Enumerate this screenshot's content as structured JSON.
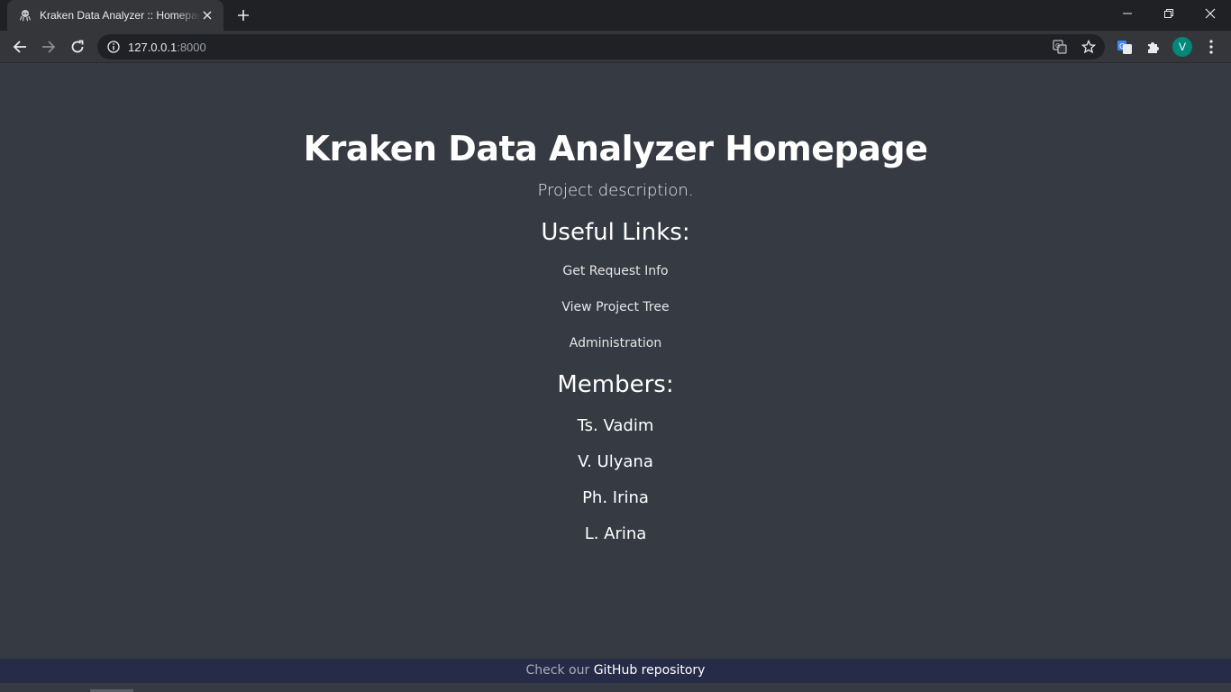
{
  "browser": {
    "tab_title": "Kraken Data Analyzer :: Homepage",
    "url_host": "127.0.0.1",
    "url_port": ":8000",
    "avatar_letter": "V",
    "colors": {
      "titlebar": "#202124",
      "toolbar": "#35363a",
      "omnibox": "#202124",
      "avatar": "#00897b"
    }
  },
  "page": {
    "title": "Kraken Data Analyzer Homepage",
    "description": "Project description.",
    "links_heading": "Useful Links:",
    "links": [
      {
        "label": "Get Request Info"
      },
      {
        "label": "View Project Tree"
      },
      {
        "label": "Administration"
      }
    ],
    "members_heading": "Members:",
    "members": [
      {
        "name": "Ts. Vadim"
      },
      {
        "name": "V. Ulyana"
      },
      {
        "name": "Ph. Irina"
      },
      {
        "name": "L. Arina"
      }
    ],
    "colors": {
      "background": "#363a42",
      "footer": "#262b47"
    }
  },
  "footer": {
    "prefix": "Check our",
    "link_text": "GitHub repository"
  }
}
